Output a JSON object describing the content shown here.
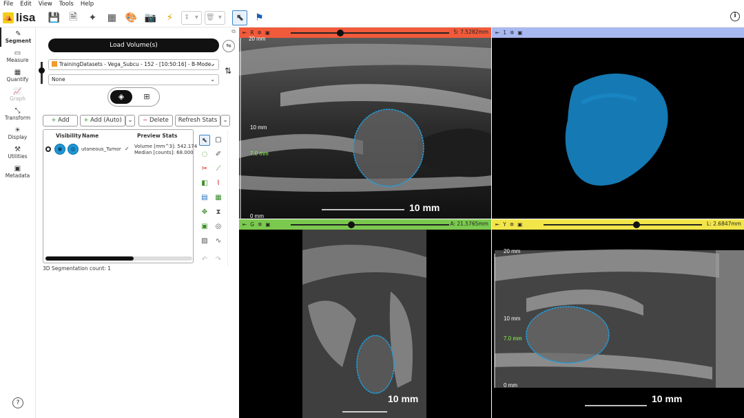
{
  "menu": [
    "File",
    "Edit",
    "View",
    "Tools",
    "Help"
  ],
  "app": {
    "logo_text": "lisa"
  },
  "sidebar": {
    "items": [
      {
        "label": "Segment",
        "icon": "pencil-icon",
        "glyph": "✎"
      },
      {
        "label": "Measure",
        "icon": "ruler-icon",
        "glyph": "▭"
      },
      {
        "label": "Quantify",
        "icon": "table-icon",
        "glyph": "▦"
      },
      {
        "label": "Graph",
        "icon": "graph-icon",
        "glyph": "📈"
      },
      {
        "label": "Transform",
        "icon": "transform-icon",
        "glyph": "⤡"
      },
      {
        "label": "Display",
        "icon": "display-icon",
        "glyph": "☀"
      },
      {
        "label": "Utilities",
        "icon": "tools-icon",
        "glyph": "⚒"
      },
      {
        "label": "Metadata",
        "icon": "metadata-icon",
        "glyph": "▣"
      }
    ],
    "help": "?"
  },
  "panel": {
    "load_button": "Load Volume(s)",
    "volume_select": "TrainingDatasets - Vega_Subcu - 152 - [10:50:16] - B-Mode -",
    "second_select": "None",
    "actions": {
      "add": "Add",
      "add_auto": "Add (Auto)",
      "delete": "Delete",
      "refresh": "Refresh Stats"
    },
    "table": {
      "headers": [
        "Visibility",
        "Name",
        "Preview Stats"
      ],
      "rows": [
        {
          "name": "utaneous_Tumor",
          "stats_volume": "Volume [mm^3]: 542.174",
          "stats_median": "Median [counts]: 68.000"
        }
      ]
    },
    "seg_count": "3D Segmentation count: 1"
  },
  "viewports": {
    "top_left": {
      "id": "R",
      "readout": "S: 7.5282mm",
      "color": "#f15a3a",
      "scale_label": "10 mm",
      "ticks": [
        "20 mm",
        "10 mm",
        "7.0 mm",
        "0 mm"
      ]
    },
    "top_right": {
      "id": "1",
      "color": "#a8b8f0"
    },
    "bottom_left": {
      "id": "G",
      "readout": "A: 21.5765mm",
      "color": "#7bc94f",
      "scale_label": "10 mm"
    },
    "bottom_right": {
      "id": "Y",
      "readout": "L: 2.6847mm",
      "color": "#f2e54a",
      "scale_label": "10 mm",
      "ticks": [
        "20 mm",
        "10 mm",
        "7.0 mm",
        "0 mm"
      ]
    }
  },
  "colors": {
    "segmentation_outline": "#1aa3e8",
    "render_3d": "#1579b3"
  }
}
